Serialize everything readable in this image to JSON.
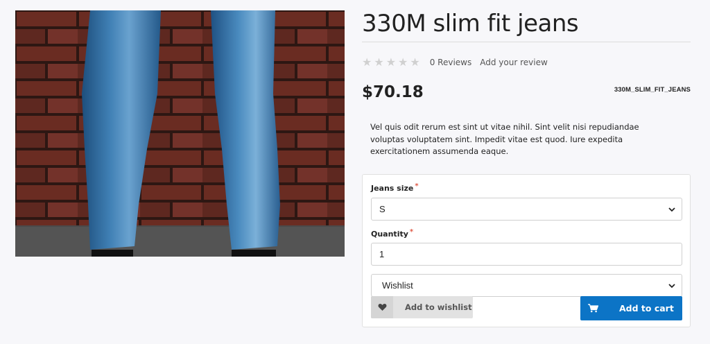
{
  "product": {
    "title": "330M slim fit jeans",
    "image_alt": "Jeans image",
    "rating": {
      "stars": 0,
      "max": 5,
      "reviews_label": "0 Reviews",
      "add_review_label": "Add your review"
    },
    "price": "$70.18",
    "sku": "330M_SLIM_FIT_JEANS",
    "description": "Vel quis odit rerum est sint ut vitae nihil. Sint velit nisi repudiandae voluptas voluptatem sint. Impedit vitae est quod. Iure expedita exercitationem assumenda eaque."
  },
  "options": {
    "size": {
      "label": "Jeans size",
      "required_mark": "*",
      "selected": "S"
    },
    "quantity": {
      "label": "Quantity",
      "required_mark": "*",
      "value": "1"
    },
    "wishlist_select": {
      "selected": "Wishlist"
    }
  },
  "actions": {
    "add_to_wishlist": "Add to wishlist",
    "add_to_cart": "Add to cart"
  },
  "icons": {
    "star": "star-icon",
    "heart": "heart-icon",
    "cart": "cart-icon",
    "chevron": "chevron-down-icon"
  },
  "colors": {
    "background": "#f7f7fa",
    "primary_button": "#0c74c6",
    "secondary_button": "#e2e2e2",
    "required_asterisk": "#e05a47",
    "star_inactive": "#d0d0d0"
  }
}
